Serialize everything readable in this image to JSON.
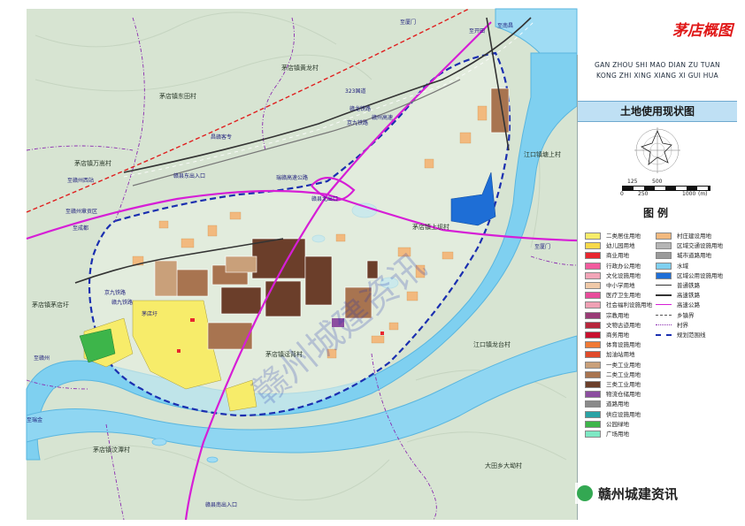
{
  "brand": {
    "text": "茅店概图"
  },
  "panel": {
    "pinyin_line1": "GAN ZHOU SHI MAO DIAN ZU TUAN",
    "pinyin_line2": "KONG ZHI XING XIANG XI GUI HUA",
    "title": "土地使用现状图",
    "legend_title": "图例",
    "scale": {
      "upper": [
        "125",
        "500"
      ],
      "lower": [
        "0",
        "250",
        "1000",
        "(m)"
      ]
    },
    "legend_left": [
      {
        "label": "二类居住用地",
        "color": "#f7ec6a"
      },
      {
        "label": "幼儿园用地",
        "color": "#f7d94a"
      },
      {
        "label": "商业用地",
        "color": "#e8262f"
      },
      {
        "label": "行政办公用地",
        "color": "#f25c9e"
      },
      {
        "label": "文化设施用地",
        "color": "#f3a5b8"
      },
      {
        "label": "中小学用地",
        "color": "#f0c9a8"
      },
      {
        "label": "医疗卫生用地",
        "color": "#e84c9b"
      },
      {
        "label": "社会福利设施用地",
        "color": "#f0a0b4"
      },
      {
        "label": "宗教用地",
        "color": "#9a3a76"
      },
      {
        "label": "文物古迹用地",
        "color": "#b7263b"
      },
      {
        "label": "商务用地",
        "color": "#c8102e"
      },
      {
        "label": "体育设施用地",
        "color": "#f07a36"
      },
      {
        "label": "加油站用地",
        "color": "#e04a2a"
      },
      {
        "label": "一类工业用地",
        "color": "#c9a07a"
      },
      {
        "label": "二类工业用地",
        "color": "#a87450"
      },
      {
        "label": "三类工业用地",
        "color": "#6b3e2a"
      },
      {
        "label": "物流仓储用地",
        "color": "#8c4ea0"
      },
      {
        "label": "道路用地",
        "color": "#8a8a8a"
      },
      {
        "label": "供应设施用地",
        "color": "#2aa3a5"
      },
      {
        "label": "公园绿地",
        "color": "#3db54a"
      },
      {
        "label": "广场用地",
        "color": "#7ee8c4"
      }
    ],
    "legend_right": [
      {
        "label": "村庄建设用地",
        "color": "#f2b97e",
        "kind": "fill"
      },
      {
        "label": "区域交通设施用地",
        "color": "#b5b5b5",
        "kind": "fill"
      },
      {
        "label": "城市道路用地",
        "color": "#9a9a9a",
        "kind": "fill"
      },
      {
        "label": "水域",
        "color": "#7fd0f0",
        "kind": "fill"
      },
      {
        "label": "区域公用设施用地",
        "color": "#1e6ed6",
        "kind": "fill"
      },
      {
        "label": "普通铁路",
        "color": "#333333",
        "kind": "rail"
      },
      {
        "label": "高速铁路",
        "color": "#333333",
        "kind": "rail2"
      },
      {
        "label": "高速公路",
        "color": "#d61ed6",
        "kind": "line"
      },
      {
        "label": "乡镇界",
        "color": "#555555",
        "kind": "dash"
      },
      {
        "label": "村界",
        "color": "#8a2ab0",
        "kind": "dashdot"
      },
      {
        "label": "规划范围线",
        "color": "#1b2fb0",
        "kind": "thickdash"
      }
    ]
  },
  "labels": {
    "villages": [
      "茅店镇黄龙村",
      "茅店镇东田村",
      "茅店镇万嵩村",
      "茅店镇茅店圩",
      "茅店镇汶潭村",
      "江口镇塘上村",
      "江口镇龙台村",
      "大田乡大坳村",
      "茅店镇迳背村",
      "茅店镇上坝村"
    ],
    "roads": [
      "昌赣客专",
      "323国道",
      "京九铁路",
      "赣龙铁路",
      "赣州高速",
      "瑞赣高速公路",
      "京九铁路",
      "赣九铁路",
      "至赣州西站",
      "至赣州章贡区",
      "至成都",
      "至厦门",
      "至开田",
      "至南昌",
      "至厦门",
      "至赣州",
      "至瑞金",
      "赣县东出入口",
      "赣县北出口",
      "赣县南出入口",
      "茅店圩"
    ],
    "watermark": "赣州城建资讯"
  }
}
